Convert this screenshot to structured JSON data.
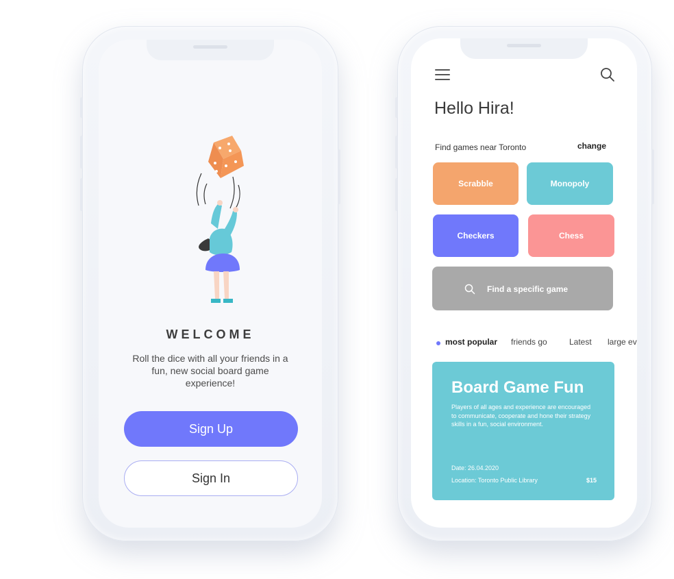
{
  "welcome_screen": {
    "title": "WELCOME",
    "description": "Roll the dice with all your friends in a fun, new social board game experience!",
    "sign_up_label": "Sign Up",
    "sign_in_label": "Sign In",
    "illustration": "girl-tossing-dice-illustration"
  },
  "home_screen": {
    "menu_icon": "hamburger-menu-icon",
    "search_icon": "search-icon",
    "greeting": "Hello Hira!",
    "location_text": "Find games near Toronto",
    "change_label": "change",
    "game_tiles": [
      {
        "label": "Scrabble",
        "color": "#f4a56d"
      },
      {
        "label": "Monopoly",
        "color": "#6ccad6"
      },
      {
        "label": "Checkers",
        "color": "#7078fb"
      },
      {
        "label": "Chess",
        "color": "#fb9595"
      }
    ],
    "find_game_label": "Find a specific game",
    "filters": [
      "most popular",
      "friends go",
      "Latest",
      "large ev"
    ],
    "active_filter": "most popular",
    "event": {
      "title": "Board Game Fun",
      "description": "Players of all ages and experience are encouraged to communicate, cooperate and hone their strategy skills in a fun, social environment.",
      "date": "Date: 26.04.2020",
      "location": "Location:  Toronto Public Library",
      "price": "$15"
    }
  },
  "colors": {
    "primary": "#7078fb",
    "orange": "#f4a56d",
    "teal": "#6ccad6",
    "pink": "#fb9595",
    "gray_button": "#a9a9a9"
  }
}
